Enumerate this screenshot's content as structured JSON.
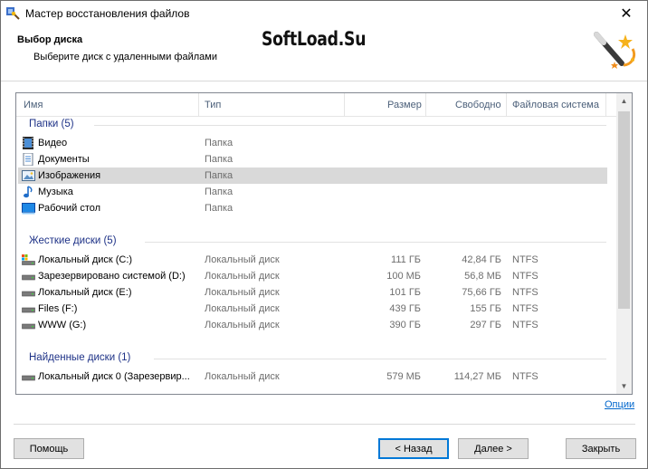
{
  "window": {
    "title": "Мастер восстановления файлов",
    "close_glyph": "✕"
  },
  "header": {
    "title": "Выбор диска",
    "subtitle": "Выберите диск с удаленными файлами",
    "watermark": "SoftLoad.Su"
  },
  "columns": {
    "name": "Имя",
    "type": "Тип",
    "size": "Размер",
    "free": "Свободно",
    "fs": "Файловая система"
  },
  "groups": [
    {
      "title": "Папки (5)",
      "rows": [
        {
          "name": "Видео",
          "type": "Папка",
          "size": "",
          "free": "",
          "fs": "",
          "icon": "video-folder-icon"
        },
        {
          "name": "Документы",
          "type": "Папка",
          "size": "",
          "free": "",
          "fs": "",
          "icon": "documents-folder-icon"
        },
        {
          "name": "Изображения",
          "type": "Папка",
          "size": "",
          "free": "",
          "fs": "",
          "icon": "pictures-folder-icon"
        },
        {
          "name": "Музыка",
          "type": "Папка",
          "size": "",
          "free": "",
          "fs": "",
          "icon": "music-folder-icon"
        },
        {
          "name": "Рабочий стол",
          "type": "Папка",
          "size": "",
          "free": "",
          "fs": "",
          "icon": "desktop-folder-icon"
        }
      ]
    },
    {
      "title": "Жесткие диски (5)",
      "rows": [
        {
          "name": "Локальный диск (C:)",
          "type": "Локальный диск",
          "size": "111 ГБ",
          "free": "42,84 ГБ",
          "fs": "NTFS",
          "icon": "system-drive-icon"
        },
        {
          "name": "Зарезервировано системой (D:)",
          "type": "Локальный диск",
          "size": "100 МБ",
          "free": "56,8 МБ",
          "fs": "NTFS",
          "icon": "drive-icon"
        },
        {
          "name": "Локальный диск (E:)",
          "type": "Локальный диск",
          "size": "101 ГБ",
          "free": "75,66 ГБ",
          "fs": "NTFS",
          "icon": "drive-icon"
        },
        {
          "name": "Files (F:)",
          "type": "Локальный диск",
          "size": "439 ГБ",
          "free": "155 ГБ",
          "fs": "NTFS",
          "icon": "drive-icon"
        },
        {
          "name": "WWW (G:)",
          "type": "Локальный диск",
          "size": "390 ГБ",
          "free": "297 ГБ",
          "fs": "NTFS",
          "icon": "drive-icon"
        }
      ]
    },
    {
      "title": "Найденные диски (1)",
      "rows": [
        {
          "name": "Локальный диск 0 (Зарезервир...",
          "type": "Локальный диск",
          "size": "579 МБ",
          "free": "114,27 МБ",
          "fs": "NTFS",
          "icon": "drive-icon"
        }
      ]
    }
  ],
  "selected_row": "Изображения",
  "options_link": "Опции",
  "buttons": {
    "help": "Помощь",
    "back": "< Назад",
    "next": "Далее >",
    "close": "Закрыть"
  }
}
